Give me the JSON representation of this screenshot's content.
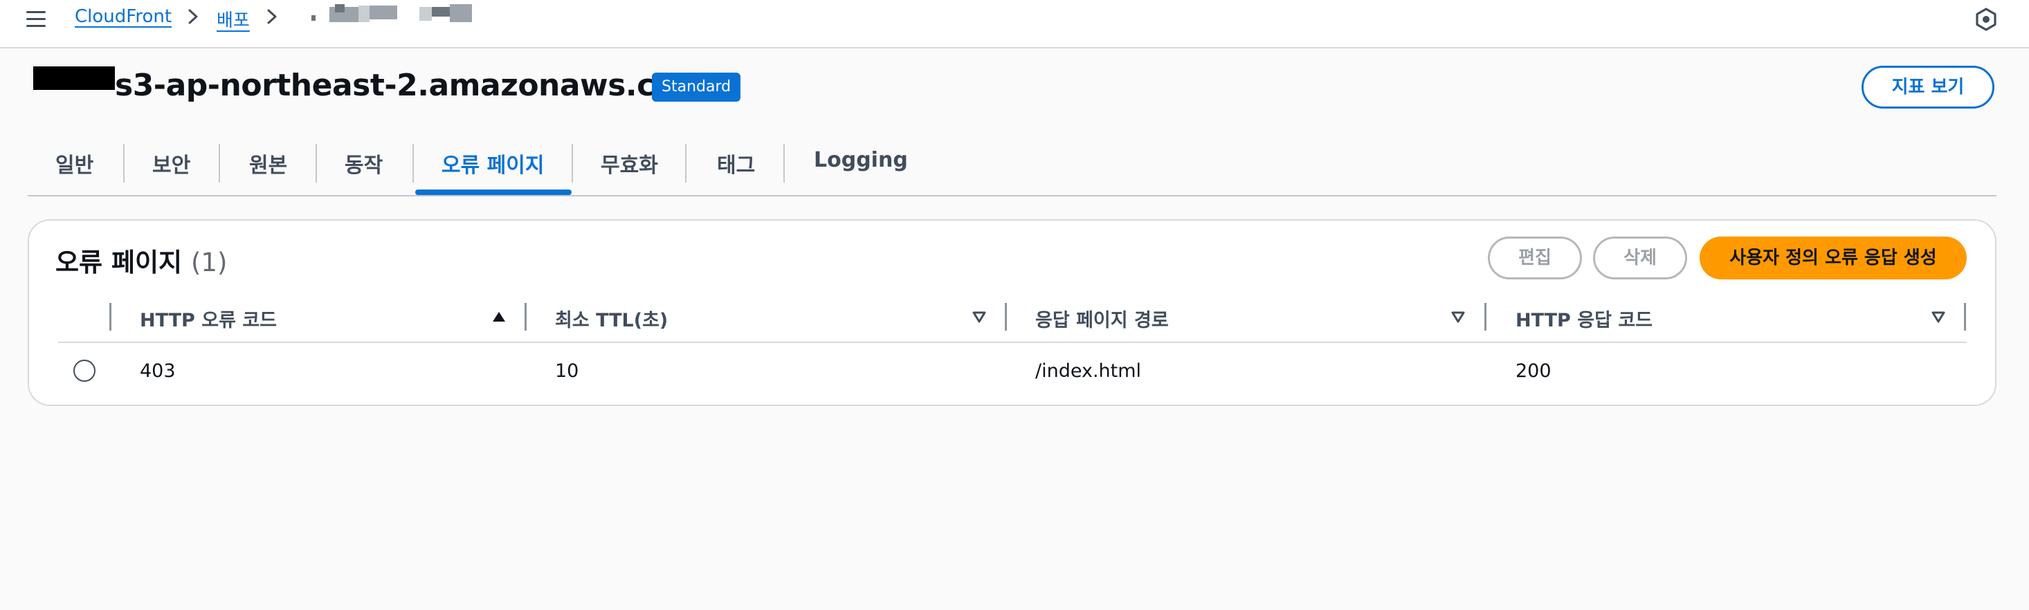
{
  "breadcrumb": {
    "home": "CloudFront",
    "section": "배포"
  },
  "header": {
    "title": "s3-ap-northeast-2.amazonaws.com",
    "badge": "Standard",
    "metrics_button": "지표 보기"
  },
  "tabs": [
    {
      "label": "일반"
    },
    {
      "label": "보안"
    },
    {
      "label": "원본"
    },
    {
      "label": "동작"
    },
    {
      "label": "오류 페이지",
      "active": true
    },
    {
      "label": "무효화"
    },
    {
      "label": "태그"
    },
    {
      "label": "Logging"
    }
  ],
  "error_pages": {
    "title": "오류 페이지",
    "count": "(1)",
    "edit_button": "편집",
    "delete_button": "삭제",
    "create_button": "사용자 정의 오류 응답 생성",
    "columns": [
      "HTTP 오류 코드",
      "최소 TTL(초)",
      "응답 페이지 경로",
      "HTTP 응답 코드"
    ],
    "rows": [
      {
        "error_code": "403",
        "min_ttl": "10",
        "response_path": "/index.html",
        "response_code": "200",
        "selected": false
      }
    ]
  },
  "colors": {
    "accent": "#0972d3",
    "primary_button": "#ff9900",
    "text": "#0f141a"
  },
  "icons": [
    "menu-icon",
    "chevron-right-icon",
    "settings-hex-icon",
    "sort-ascending-icon",
    "sort-descending-icon"
  ]
}
